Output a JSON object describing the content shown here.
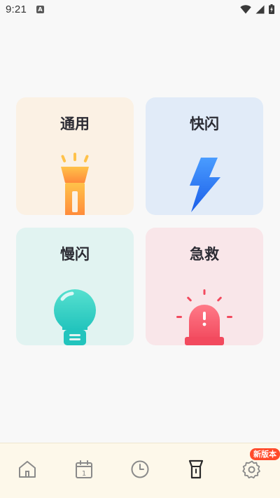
{
  "status_bar": {
    "time": "9:21",
    "notification_glyph": "A",
    "icons": [
      "wifi-icon",
      "signal-icon",
      "battery-icon"
    ]
  },
  "modes": [
    {
      "label": "通用",
      "icon": "flashlight-icon"
    },
    {
      "label": "快闪",
      "icon": "lightning-icon"
    },
    {
      "label": "慢闪",
      "icon": "bulb-icon"
    },
    {
      "label": "急救",
      "icon": "siren-icon"
    }
  ],
  "bottom_nav": {
    "items": [
      "home-icon",
      "calendar-icon",
      "clock-icon",
      "flashlight-icon",
      "gear-icon"
    ],
    "calendar_day": "1",
    "active": "flashlight-icon",
    "badge": "新版本"
  },
  "colors": {
    "accent_badge": "#ff4a2a",
    "nav_bg": "#fdf8ea"
  }
}
